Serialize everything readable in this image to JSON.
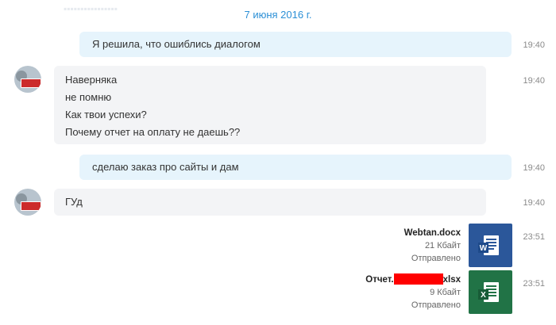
{
  "date_separator": "7 июня 2016 г.",
  "messages": [
    {
      "direction": "out",
      "lines": [
        "Я решила, что ошиблись диалогом"
      ],
      "time": "19:40"
    },
    {
      "direction": "in",
      "lines": [
        "Наверняка",
        "не помню",
        "Как твои успехи?",
        "Почему отчет на оплату не даешь??"
      ],
      "time": "19:40"
    },
    {
      "direction": "out",
      "lines": [
        "сделаю заказ про сайты и дам"
      ],
      "time": "19:40"
    },
    {
      "direction": "in",
      "lines": [
        "ГУд"
      ],
      "time": "19:40"
    }
  ],
  "files": [
    {
      "name": "Webtan.docx",
      "size": "21 Кбайт",
      "status": "Отправлено",
      "time": "23:51",
      "type": "word-document-icon",
      "color": "#2b579a"
    },
    {
      "name_prefix": "Отчет.",
      "name_suffix": "xlsx",
      "size": "9 Кбайт",
      "status": "Отправлено",
      "time": "23:51",
      "type": "excel-spreadsheet-icon",
      "color": "#217346"
    }
  ],
  "colors": {
    "date": "#2b8fd6",
    "outgoing_bubble": "#e6f4fc",
    "incoming_bubble": "#f3f4f6",
    "redaction": "#ff0000"
  }
}
